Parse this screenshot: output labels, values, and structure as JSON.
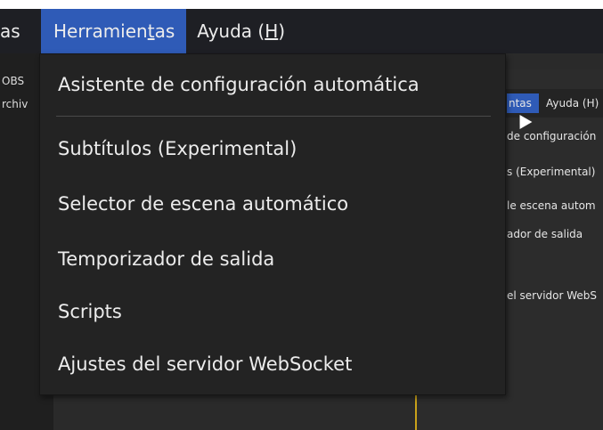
{
  "menubar": {
    "items": [
      {
        "label": "as",
        "mnemonic": ""
      },
      {
        "label": "Herramientas",
        "mnemonic": "t"
      },
      {
        "label": "Ayuda (H)",
        "mnemonic": "H"
      }
    ],
    "active_index": 1
  },
  "dropdown": {
    "items": [
      "Asistente de configuración automática",
      "Subtítulos (Experimental)",
      "Selector de escena automático",
      "Temporizador de salida",
      "Scripts",
      "Ajustes del servidor WebSocket"
    ]
  },
  "background": {
    "left_labels": [
      "OBS",
      "rchiv"
    ],
    "inner_menubar": {
      "active_label": "ntas",
      "next_label": "Ayuda (H)"
    },
    "inner_items": [
      "de configuración",
      "s (Experimental)",
      "le escena autom",
      "ador de salida",
      "el servidor WebS"
    ]
  },
  "colors": {
    "menubar_bg": "#1e1f24",
    "active_bg": "#2f5bb7",
    "dropdown_bg": "#232323",
    "accent_line": "#c9a21a"
  }
}
